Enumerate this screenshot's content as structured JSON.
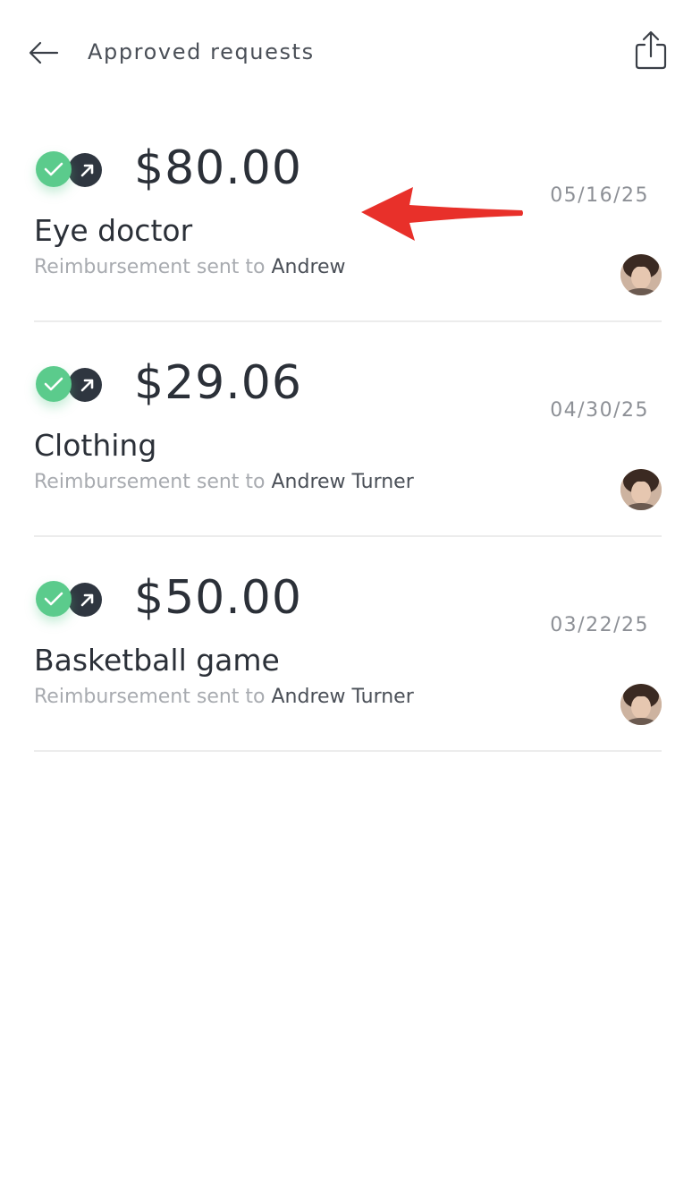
{
  "header": {
    "title": "Approved requests",
    "back_icon": "arrow-left-icon",
    "share_icon": "share-icon"
  },
  "colors": {
    "approved_green": "#5bcb8c",
    "sent_dark": "#2f3640",
    "annotation_red": "#e8302a"
  },
  "requests": [
    {
      "amount": "$80.00",
      "date": "05/16/25",
      "title": "Eye doctor",
      "subtitle_prefix": "Reimbursement sent to",
      "recipient": "Andrew"
    },
    {
      "amount": "$29.06",
      "date": "04/30/25",
      "title": "Clothing",
      "subtitle_prefix": "Reimbursement sent to",
      "recipient": "Andrew Turner"
    },
    {
      "amount": "$50.00",
      "date": "03/22/25",
      "title": "Basketball game",
      "subtitle_prefix": "Reimbursement sent to",
      "recipient": "Andrew Turner"
    }
  ]
}
